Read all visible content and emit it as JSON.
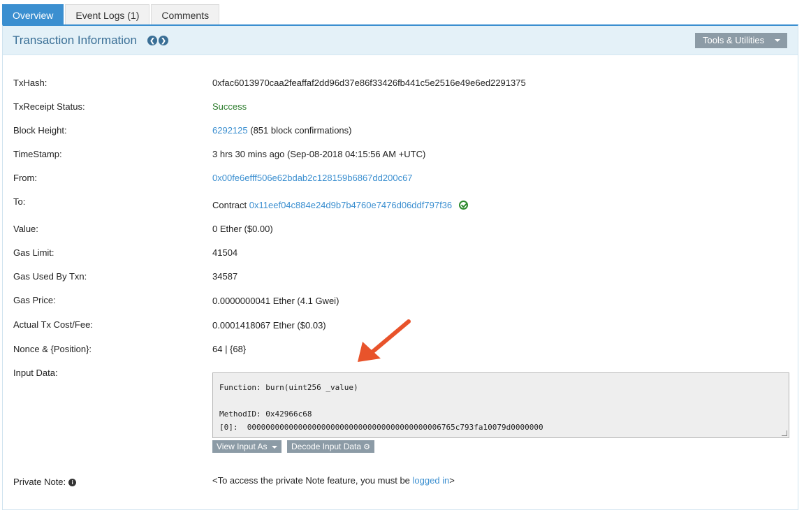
{
  "tabs": [
    {
      "label": "Overview",
      "active": true
    },
    {
      "label": "Event Logs (1)",
      "active": false
    },
    {
      "label": "Comments",
      "active": false
    }
  ],
  "header": {
    "title": "Transaction Information",
    "prev_icon": "chevron-left-circle-icon",
    "next_icon": "chevron-right-circle-icon",
    "tools_label": "Tools & Utilities"
  },
  "fields": {
    "txhash": {
      "label": "TxHash:",
      "value": "0xfac6013970caa2feaffaf2dd96d37e86f33426fb441c5e2516e49e6ed2291375"
    },
    "status": {
      "label": "TxReceipt Status:",
      "value": "Success"
    },
    "block": {
      "label": "Block Height:",
      "value": "6292125",
      "suffix": "(851 block confirmations)"
    },
    "timestamp": {
      "label": "TimeStamp:",
      "value": "3 hrs 30 mins ago (Sep-08-2018 04:15:56 AM +UTC)"
    },
    "from": {
      "label": "From:",
      "value": "0x00fe6efff506e62bdab2c128159b6867dd200c67"
    },
    "to": {
      "label": "To:",
      "prefix": "Contract",
      "value": "0x11eef04c884e24d9b7b4760e7476d06ddf797f36"
    },
    "value": {
      "label": "Value:",
      "value": "0 Ether ($0.00)"
    },
    "gas_limit": {
      "label": "Gas Limit:",
      "value": "41504"
    },
    "gas_used": {
      "label": "Gas Used By Txn:",
      "value": "34587"
    },
    "gas_price": {
      "label": "Gas Price:",
      "value": "0.0000000041 Ether (4.1 Gwei)"
    },
    "tx_fee": {
      "label": "Actual Tx Cost/Fee:",
      "value": "0.0001418067 Ether ($0.03)"
    },
    "nonce": {
      "label": "Nonce & {Position}:",
      "value": "64 | {68}"
    },
    "input": {
      "label": "Input Data:",
      "function_line": "Function: burn(uint256 _value)",
      "method_line": "MethodID: 0x42966c68",
      "param_line": "[0]:  000000000000000000000000000000000000000006765c793fa10079d0000000",
      "view_label": "View Input As",
      "decode_label": "Decode Input Data"
    },
    "private_note": {
      "label": "Private Note:",
      "text_before": "<To access the private Note feature, you must be ",
      "link_text": "logged in",
      "text_after": ">"
    }
  },
  "colors": {
    "accent": "#3b8fd0",
    "success": "#2d7c2d",
    "annotation_arrow": "#e8532b"
  }
}
